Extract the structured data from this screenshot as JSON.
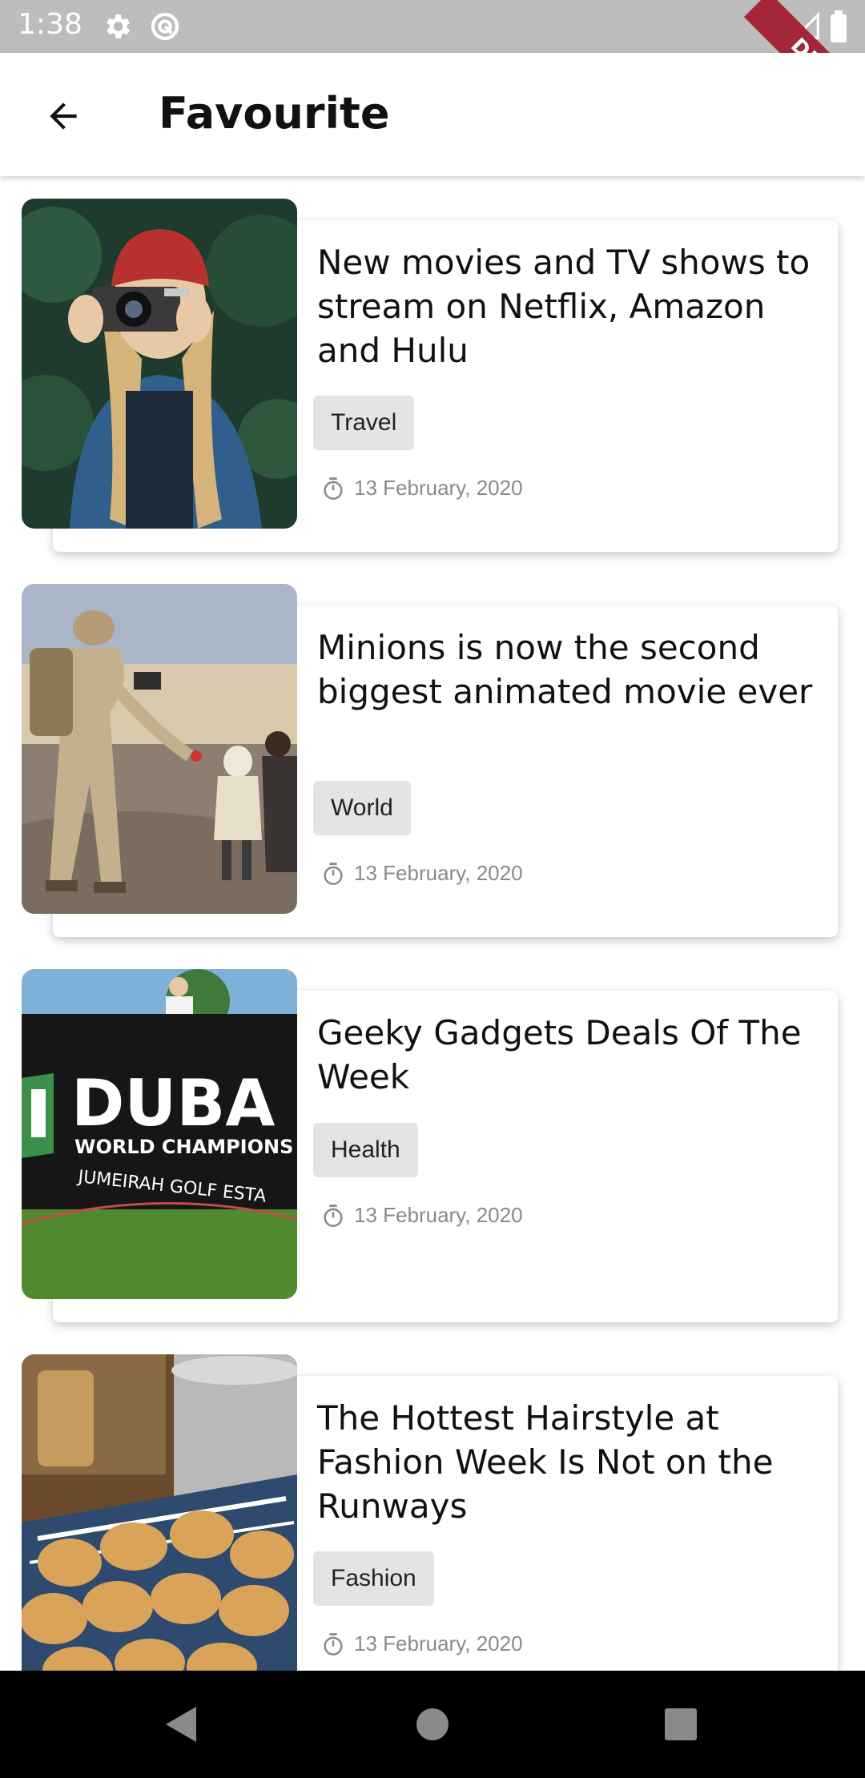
{
  "status_bar": {
    "time": "1:38",
    "icons": [
      "settings-icon",
      "sync-icon",
      "wifi-icon",
      "signal-icon",
      "battery-icon"
    ]
  },
  "debug_banner": {
    "label": "DEBUG",
    "color": "#a3263a"
  },
  "app_bar": {
    "title": "Favourite",
    "back_icon": "arrow-back-icon"
  },
  "articles": [
    {
      "title": "New movies and TV shows to stream on Netflix, Amazon and Hulu",
      "category": "Travel",
      "date": "13 February, 2020",
      "image": "woman-with-camera-photo"
    },
    {
      "title": "Minions is now the second biggest animated movie ever",
      "category": "World",
      "date": "13 February, 2020",
      "image": "soldier-with-children-photo"
    },
    {
      "title": "Geeky Gadgets Deals Of The Week",
      "category": "Health",
      "date": "13 February, 2020",
      "image": "dubai-golf-banner-photo"
    },
    {
      "title": "The Hottest Hairstyle at Fashion Week Is Not on the Runways",
      "category": "Fashion",
      "date": "13 February, 2020",
      "image": "potatoes-photo"
    }
  ],
  "nav_bar": {
    "buttons": [
      "back-triangle-icon",
      "home-circle-icon",
      "recents-square-icon"
    ]
  },
  "colors": {
    "status_bar": "#bdbdbd",
    "chip_bg": "#e4e4e4",
    "date_text": "#8a8a8a",
    "nav_bar": "#000000"
  }
}
